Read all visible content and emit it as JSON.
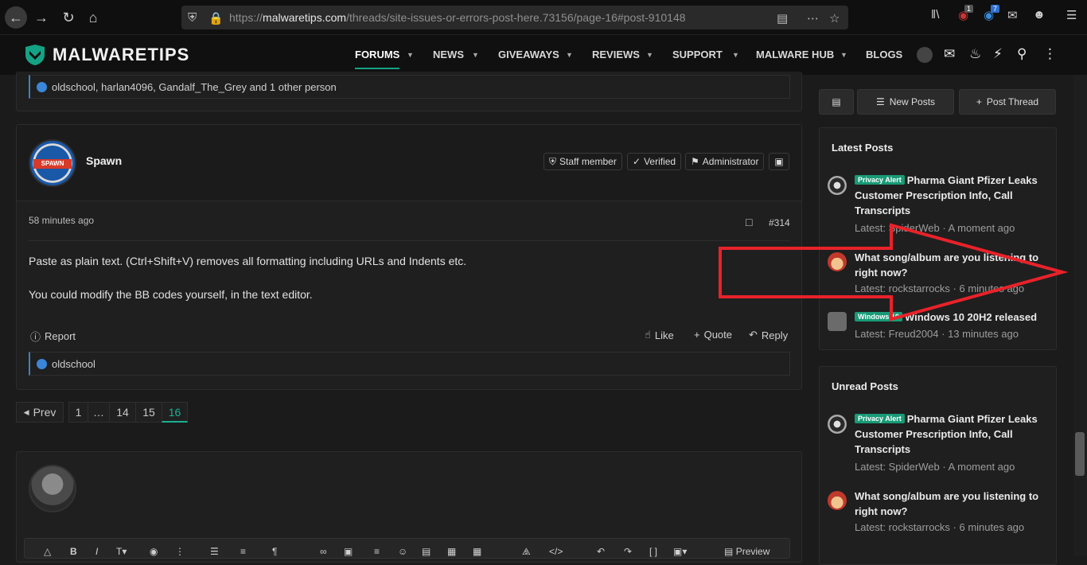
{
  "browser": {
    "url_prefix": "https://",
    "url_domain": "malwaretips.com",
    "url_path": "/threads/site-issues-or-errors-post-here.73156/page-16#post-910148",
    "ublock_count": "1",
    "ext_count": "7"
  },
  "site": {
    "logo": "MALWARETIPS",
    "nav": [
      "FORUMS",
      "NEWS",
      "GIVEAWAYS",
      "REVIEWS",
      "SUPPORT",
      "MALWARE HUB",
      "BLOGS"
    ]
  },
  "prev_post": {
    "reactions": "oldschool, harlan4096, Gandalf_The_Grey and 1 other person"
  },
  "post": {
    "author": "Spawn",
    "avatar_text": "SPAWN",
    "badges": [
      "Staff member",
      "Verified",
      "Administrator"
    ],
    "time": "58 minutes ago",
    "number": "#314",
    "body": [
      "Paste as plain text. (Ctrl+Shift+V) removes all formatting including URLs and Indents etc.",
      "You could modify the BB codes yourself, in the text editor."
    ],
    "report": "Report",
    "like": "Like",
    "quote": "Quote",
    "reply": "Reply",
    "reactions": "oldschool"
  },
  "pagination": {
    "prev": "Prev",
    "pages": [
      "1",
      "…",
      "14",
      "15",
      "16"
    ],
    "current": "16"
  },
  "editor": {
    "preview": "Preview"
  },
  "sidebar": {
    "new_posts": "New Posts",
    "post_thread": "Post Thread",
    "latest_title": "Latest Posts",
    "latest": [
      {
        "tag": "Privacy Alert",
        "title": "Pharma Giant Pfizer Leaks Customer Prescription Info, Call Transcripts",
        "meta": "Latest: SpiderWeb · A moment ago"
      },
      {
        "tag": "",
        "title": "What song/album are you listening to right now?",
        "meta": "Latest: rockstarrocks · 6 minutes ago"
      },
      {
        "tag": "Windows 10",
        "title": "Windows 10 20H2 released",
        "meta": "Latest: Freud2004 · 13 minutes ago"
      }
    ],
    "unread_title": "Unread Posts",
    "unread": [
      {
        "tag": "Privacy Alert",
        "title": "Pharma Giant Pfizer Leaks Customer Prescription Info, Call Transcripts",
        "meta": "Latest: SpiderWeb · A moment ago"
      },
      {
        "tag": "",
        "title": "What song/album are you listening to right now?",
        "meta": "Latest: rockstarrocks · 6 minutes ago"
      }
    ]
  },
  "colors": {
    "accent": "#14a384",
    "annotation_arrow": "#e8222a",
    "like_blue": "#3a86d8"
  }
}
